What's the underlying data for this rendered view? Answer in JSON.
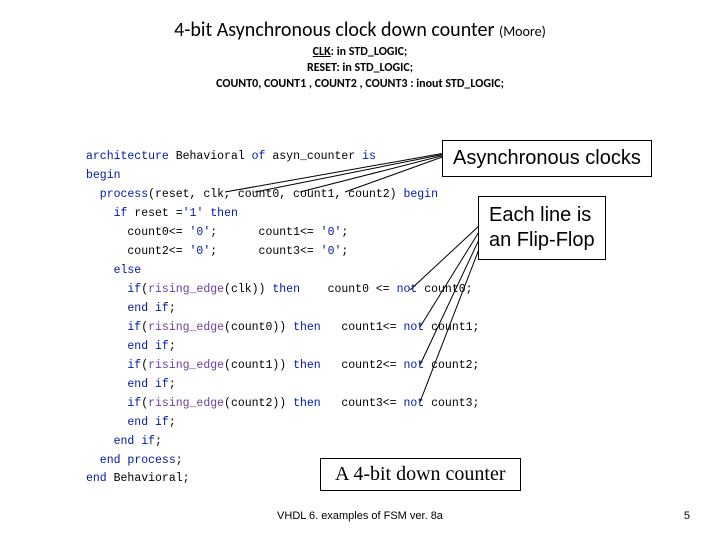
{
  "title_main": "4-bit Asynchronous clock down counter ",
  "title_paren": "(Moore)",
  "ports_line1a": "CLK",
  "ports_line1b": ": in STD_LOGIC;",
  "ports_line2": "RESET: in STD_LOGIC;",
  "ports_line3": "COUNT0, COUNT1 , COUNT2 , COUNT3 : inout STD_LOGIC;",
  "code": {
    "l0a": "architecture",
    "l0b": " Behavioral ",
    "l0c": "of",
    "l0d": " asyn_counter ",
    "l0e": "is",
    "l1": "begin",
    "l2a": "  process",
    "l2b": "(reset, clk, count0, count1, count2) ",
    "l2c": "begin",
    "l3a": "    if",
    "l3b": " reset =",
    "l3c": "'1'",
    "l3d": " then",
    "l4a": "      count0<= ",
    "l4b": "'0'",
    "l4c": ";      count1<= ",
    "l4d": "'0'",
    "l4e": ";",
    "l5a": "      count2<= ",
    "l5b": "'0'",
    "l5c": ";      count3<= ",
    "l5d": "'0'",
    "l5e": ";",
    "l6": "    else",
    "l7a": "      if",
    "l7b": "(",
    "l7c": "rising_edge",
    "l7d": "(clk)) ",
    "l7e": "then",
    "l7f": "    count0 <= ",
    "l7g": "not",
    "l7h": " count0;",
    "l8a": "      end",
    "l8b": " if",
    "l8c": ";",
    "l9a": "      if",
    "l9b": "(",
    "l9c": "rising_edge",
    "l9d": "(count0)) ",
    "l9e": "then",
    "l9f": "   count1<= ",
    "l9g": "not",
    "l9h": " count1;",
    "l10a": "      end",
    "l10b": " if",
    "l10c": ";",
    "l11a": "      if",
    "l11b": "(",
    "l11c": "rising_edge",
    "l11d": "(count1)) ",
    "l11e": "then",
    "l11f": "   count2<= ",
    "l11g": "not",
    "l11h": " count2;",
    "l12a": "      end",
    "l12b": " if",
    "l12c": ";",
    "l13a": "      if",
    "l13b": "(",
    "l13c": "rising_edge",
    "l13d": "(count2)) ",
    "l13e": "then",
    "l13f": "   count3<= ",
    "l13g": "not",
    "l13h": " count3;",
    "l14a": "      end",
    "l14b": " if",
    "l14c": ";",
    "l15a": "    end",
    "l15b": " if",
    "l15c": ";",
    "l16a": "  end",
    "l16b": " process",
    "l16c": ";",
    "l17a": "end",
    "l17b": " Behavioral;"
  },
  "callout_async": "Asynchronous clocks",
  "callout_ff_l1": "Each line is",
  "callout_ff_l2": "an Flip-Flop",
  "callout_4bit": "A 4-bit down counter",
  "footer": "VHDL 6. examples of FSM ver. 8a",
  "pagenum": "5"
}
